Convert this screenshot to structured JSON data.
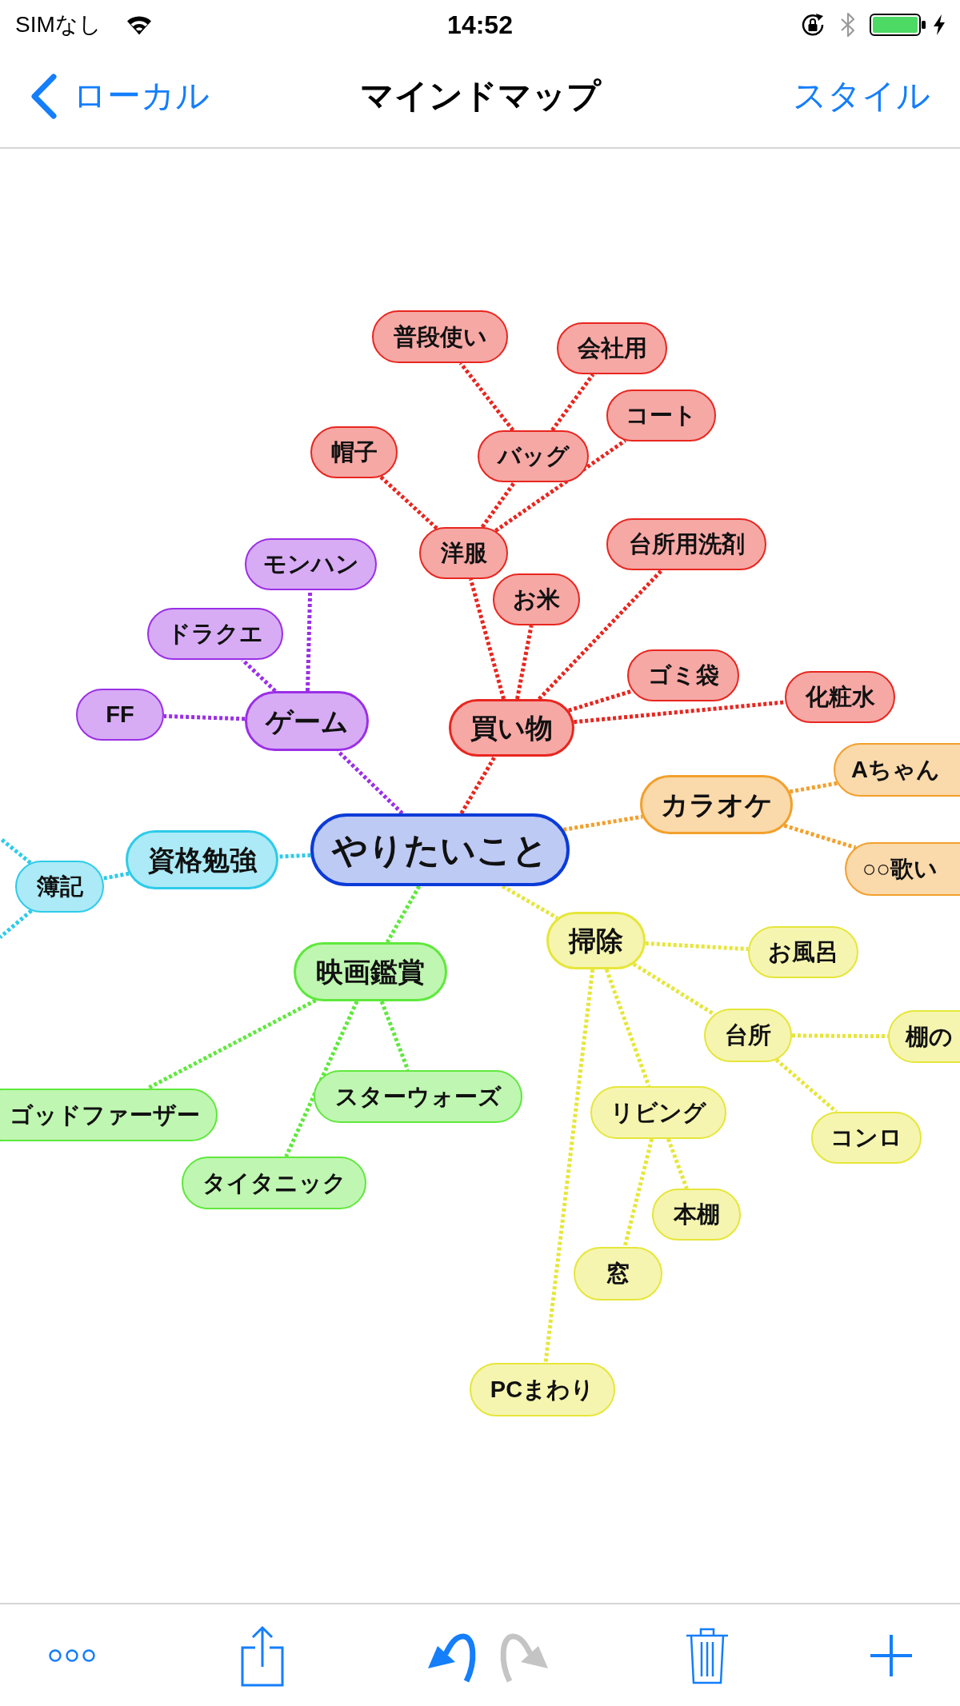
{
  "status_bar": {
    "carrier": "SIMなし",
    "time": "14:52"
  },
  "nav_bar": {
    "back": "ローカル",
    "title": "マインドマップ",
    "action": "スタイル"
  },
  "mind_map": {
    "root": {
      "label": "やりたいこと",
      "children": [
        {
          "label": "ゲーム",
          "color": "#9b2fe6",
          "children": [
            {
              "label": "モンハン"
            },
            {
              "label": "ドラクエ"
            },
            {
              "label": "FF"
            }
          ]
        },
        {
          "label": "買い物",
          "color": "#e8261f",
          "children": [
            {
              "label": "洋服",
              "children": [
                {
                  "label": "コート"
                },
                {
                  "label": "帽子"
                },
                {
                  "label": "バッグ",
                  "children": [
                    {
                      "label": "普段使い"
                    },
                    {
                      "label": "会社用"
                    }
                  ]
                }
              ]
            },
            {
              "label": "台所用洗剤"
            },
            {
              "label": "お米"
            },
            {
              "label": "ゴミ袋"
            },
            {
              "label": "化粧水"
            }
          ]
        },
        {
          "label": "カラオケ",
          "color": "#f2a02c",
          "children": [
            {
              "label": "Aちゃん"
            },
            {
              "label": "○○歌い"
            }
          ]
        },
        {
          "label": "資格勉強",
          "color": "#2ecbe9",
          "children": [
            {
              "label": "簿記"
            }
          ]
        },
        {
          "label": "掃除",
          "color": "#e6e63a",
          "children": [
            {
              "label": "お風呂"
            },
            {
              "label": "台所",
              "children": [
                {
                  "label": "棚の"
                },
                {
                  "label": "コンロ"
                }
              ]
            },
            {
              "label": "リビング",
              "children": [
                {
                  "label": "本棚"
                },
                {
                  "label": "窓"
                }
              ]
            },
            {
              "label": "PCまわり"
            }
          ]
        },
        {
          "label": "映画鑑賞",
          "color": "#5fe83d",
          "children": [
            {
              "label": "ゴッドファーザー"
            },
            {
              "label": "スターウォーズ"
            },
            {
              "label": "タイタニック"
            }
          ]
        }
      ]
    }
  },
  "toolbar": [
    {
      "kind": "more",
      "disabled": false
    },
    {
      "kind": "share",
      "disabled": false
    },
    {
      "kind": "undo",
      "disabled": false
    },
    {
      "kind": "redo",
      "disabled": true
    },
    {
      "kind": "trash",
      "disabled": false
    },
    {
      "kind": "add",
      "disabled": false
    }
  ]
}
